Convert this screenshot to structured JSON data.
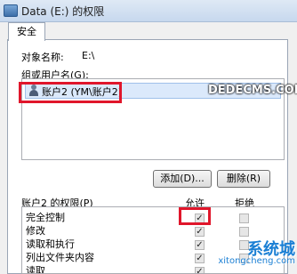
{
  "window": {
    "title": "Data (E:) 的权限"
  },
  "tabs": [
    {
      "label": "安全"
    }
  ],
  "object": {
    "label": "对象名称:",
    "value": "E:\\"
  },
  "groups": {
    "label": "组或用户名(G):",
    "items": [
      {
        "label": "账户2 (YM\\账户2)"
      }
    ]
  },
  "buttons": {
    "add": "添加(D)...",
    "remove": "删除(R)"
  },
  "permissions": {
    "header": "账户2 的权限(P)",
    "allow_header": "允许",
    "deny_header": "拒绝",
    "rows": [
      {
        "label": "完全控制",
        "allow": true,
        "deny": false
      },
      {
        "label": "修改",
        "allow": true,
        "deny": false
      },
      {
        "label": "读取和执行",
        "allow": true,
        "deny": false
      },
      {
        "label": "列出文件夹内容",
        "allow": true,
        "deny": false
      },
      {
        "label": "读取",
        "allow": true,
        "deny": false
      }
    ]
  },
  "watermark": {
    "logo": "系统城",
    "url": "xitongcheng.com",
    "site": "DEDECMS.COM"
  },
  "colors": {
    "highlight": "#e0162b",
    "selection": "#dbe9fb"
  }
}
